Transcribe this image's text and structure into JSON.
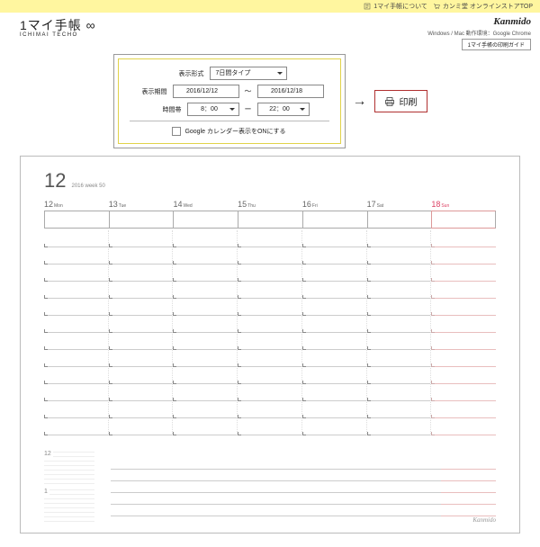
{
  "topbar": {
    "about": "1マイ手帳について",
    "store": "カンミ堂 オンラインストアTOP"
  },
  "brand": "Kanmido",
  "logo": {
    "jp": "1マイ手帳 ∞",
    "en": "ICHIMAI TECHO"
  },
  "header": {
    "env": "Windows / Mac 動作環境：Google Chrome",
    "guide": "1マイ手帳の印刷ガイド"
  },
  "settings": {
    "format_label": "表示形式",
    "format_value": "7日間タイプ",
    "period_label": "表示期間",
    "date_from": "2016/12/12",
    "date_sep": "〜",
    "date_to": "2016/12/18",
    "time_label": "時間帯",
    "time_from": "8：00",
    "time_sep": "ー",
    "time_to": "22：00",
    "gcal": "Google カレンダー表示をONにする"
  },
  "arrow": "→",
  "print": "印刷",
  "sheet": {
    "month": "12",
    "sub": "2016  week 50",
    "days": [
      {
        "num": "12",
        "dow": "Mon"
      },
      {
        "num": "13",
        "dow": "Tue"
      },
      {
        "num": "14",
        "dow": "Wed"
      },
      {
        "num": "15",
        "dow": "Thu"
      },
      {
        "num": "16",
        "dow": "Fri"
      },
      {
        "num": "17",
        "dow": "Sat"
      },
      {
        "num": "18",
        "dow": "Sun"
      }
    ],
    "mini_months": [
      "12",
      "1"
    ],
    "mark": "Kanmido"
  }
}
